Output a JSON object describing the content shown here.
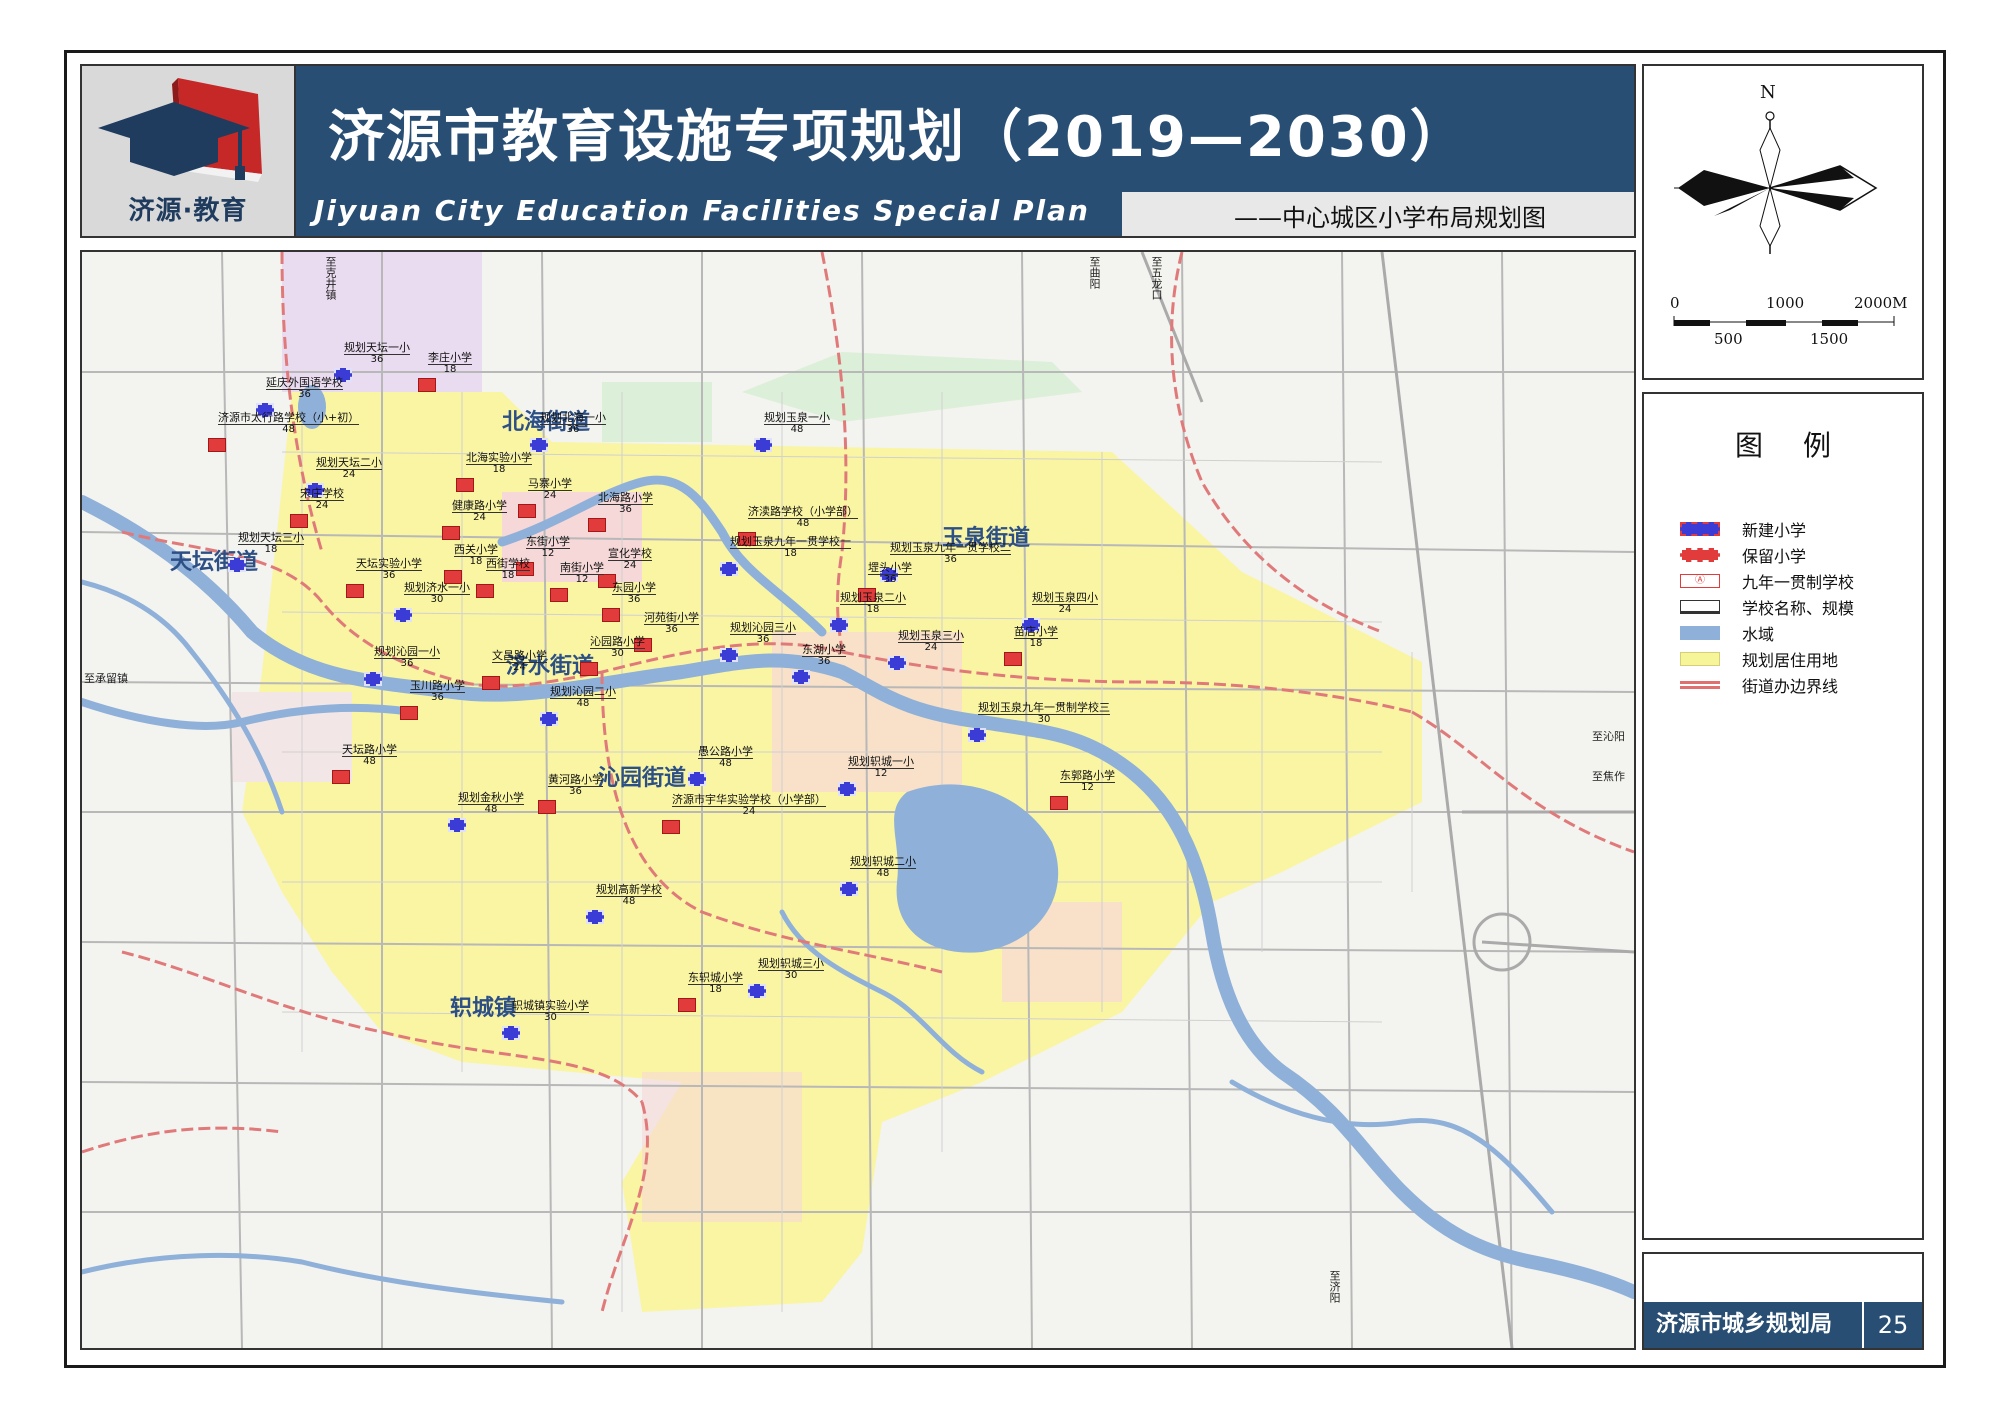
{
  "header": {
    "logo_text": "济源·教育",
    "title_cn": "济源市教育设施专项规划（2019—2030）",
    "title_en": "Jiyuan City Education Facilities Special Plan",
    "subtitle": "——中心城区小学布局规划图"
  },
  "compass": {
    "north_label": "N",
    "scale_top": [
      "0",
      "1000",
      "2000M"
    ],
    "scale_bottom": [
      "500",
      "1500"
    ]
  },
  "legend": {
    "title": "图例",
    "items": [
      {
        "label": "新建小学",
        "swatch": "new-school",
        "color": "#3b3bd6"
      },
      {
        "label": "保留小学",
        "swatch": "kept-school",
        "color": "#e23b3b"
      },
      {
        "label": "九年一贯制学校",
        "swatch": "nine-year-school",
        "color": "#e23b3b"
      },
      {
        "label": "学校名称、规模",
        "swatch": "name-scale",
        "color": "#333333"
      },
      {
        "label": "水域",
        "swatch": "water",
        "color": "#8fb0d8"
      },
      {
        "label": "规划居住用地",
        "swatch": "residential",
        "color": "#f7f59a"
      },
      {
        "label": "街道办边界线",
        "swatch": "boundary",
        "color": "#e07070"
      }
    ]
  },
  "footer": {
    "agency": "济源市城乡规划局",
    "page": "25"
  },
  "map": {
    "districts": [
      "北海街道",
      "玉泉街道",
      "天坛街道",
      "济水街道",
      "沁园街道",
      "轵城镇"
    ],
    "roads": [
      "至承留镇",
      "至沁阳",
      "至焦作",
      "至克井镇",
      "至五龙口",
      "至曲阳",
      "至济阳"
    ],
    "schools": [
      {
        "name": "规划天坛一小",
        "cap": "36",
        "kind": "new"
      },
      {
        "name": "李庄小学",
        "cap": "18",
        "kind": "kept"
      },
      {
        "name": "延庆外国语学校",
        "cap": "36",
        "kind": "new"
      },
      {
        "name": "济源市太行路学校（小+初）",
        "cap": "48",
        "kind": "kept"
      },
      {
        "name": "规划北海一小",
        "cap": "36",
        "kind": "new"
      },
      {
        "name": "规划玉泉一小",
        "cap": "48",
        "kind": "new"
      },
      {
        "name": "北海实验小学",
        "cap": "18",
        "kind": "kept"
      },
      {
        "name": "规划天坛二小",
        "cap": "24",
        "kind": "new"
      },
      {
        "name": "马寨小学",
        "cap": "24",
        "kind": "kept"
      },
      {
        "name": "宋庄学校",
        "cap": "24",
        "kind": "kept"
      },
      {
        "name": "北海路小学",
        "cap": "36",
        "kind": "kept"
      },
      {
        "name": "健康路小学",
        "cap": "24",
        "kind": "kept"
      },
      {
        "name": "济渎路学校（小学部）",
        "cap": "48",
        "kind": "kept"
      },
      {
        "name": "规划玉泉九年一贯学校一",
        "cap": "18",
        "kind": "new"
      },
      {
        "name": "规划天坛三小",
        "cap": "18",
        "kind": "new"
      },
      {
        "name": "东街小学",
        "cap": "12",
        "kind": "kept"
      },
      {
        "name": "西关小学",
        "cap": "18",
        "kind": "kept"
      },
      {
        "name": "宣化学校",
        "cap": "24",
        "kind": "kept"
      },
      {
        "name": "西街学校",
        "cap": "18",
        "kind": "kept"
      },
      {
        "name": "南街小学",
        "cap": "12",
        "kind": "kept"
      },
      {
        "name": "规划玉泉九年一贯学校二",
        "cap": "36",
        "kind": "new"
      },
      {
        "name": "天坛实验小学",
        "cap": "36",
        "kind": "kept"
      },
      {
        "name": "东园小学",
        "cap": "36",
        "kind": "kept"
      },
      {
        "name": "堽头小学",
        "cap": "36",
        "kind": "kept"
      },
      {
        "name": "规划济水一小",
        "cap": "30",
        "kind": "new"
      },
      {
        "name": "规划玉泉二小",
        "cap": "18",
        "kind": "new"
      },
      {
        "name": "规划玉泉四小",
        "cap": "24",
        "kind": "new"
      },
      {
        "name": "河苑街小学",
        "cap": "36",
        "kind": "kept"
      },
      {
        "name": "规划沁园三小",
        "cap": "36",
        "kind": "new"
      },
      {
        "name": "规划玉泉三小",
        "cap": "24",
        "kind": "new"
      },
      {
        "name": "苗店小学",
        "cap": "18",
        "kind": "kept"
      },
      {
        "name": "沁园路小学",
        "cap": "30",
        "kind": "kept"
      },
      {
        "name": "东湖小学",
        "cap": "36",
        "kind": "new"
      },
      {
        "name": "规划沁园一小",
        "cap": "36",
        "kind": "new"
      },
      {
        "name": "文昌路小学",
        "cap": "24",
        "kind": "kept"
      },
      {
        "name": "玉川路小学",
        "cap": "36",
        "kind": "kept"
      },
      {
        "name": "规划沁园二小",
        "cap": "48",
        "kind": "new"
      },
      {
        "name": "规划玉泉九年一贯制学校三",
        "cap": "30",
        "kind": "new"
      },
      {
        "name": "天坛路小学",
        "cap": "48",
        "kind": "kept"
      },
      {
        "name": "愚公路小学",
        "cap": "48",
        "kind": "new"
      },
      {
        "name": "规划轵城一小",
        "cap": "12",
        "kind": "new"
      },
      {
        "name": "东郭路小学",
        "cap": "12",
        "kind": "kept"
      },
      {
        "name": "黄河路小学",
        "cap": "36",
        "kind": "kept"
      },
      {
        "name": "济源市宇华实验学校（小学部）",
        "cap": "24",
        "kind": "kept"
      },
      {
        "name": "规划金秋小学",
        "cap": "48",
        "kind": "new"
      },
      {
        "name": "规划轵城二小",
        "cap": "48",
        "kind": "new"
      },
      {
        "name": "规划高新学校",
        "cap": "48",
        "kind": "new"
      },
      {
        "name": "东轵城小学",
        "cap": "18",
        "kind": "kept"
      },
      {
        "name": "规划轵城三小",
        "cap": "30",
        "kind": "new"
      },
      {
        "name": "轵城镇实验小学",
        "cap": "30",
        "kind": "new"
      }
    ]
  }
}
